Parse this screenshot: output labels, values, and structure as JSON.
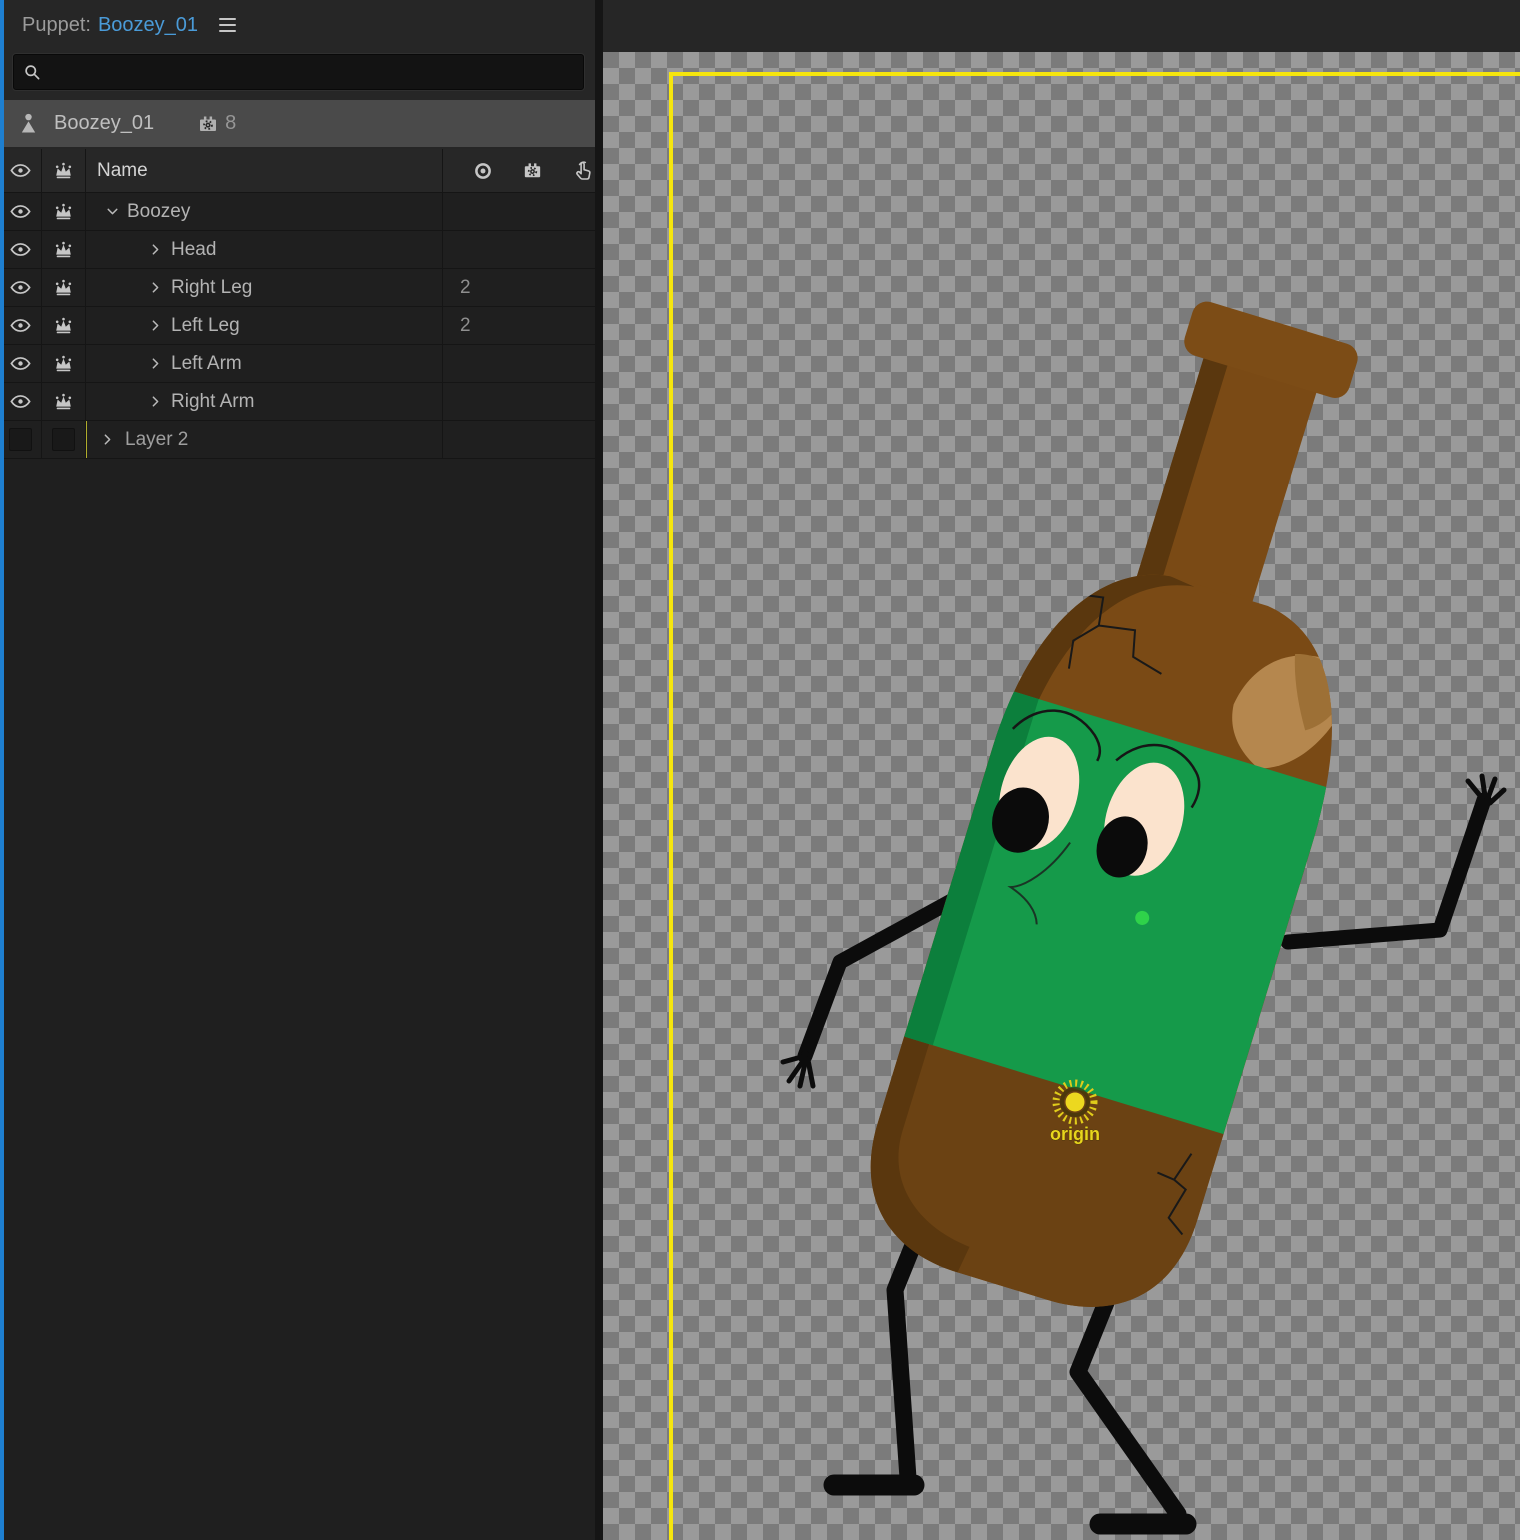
{
  "panel": {
    "accent_color": "#1e7fd0",
    "header": {
      "label": "Puppet:",
      "puppet_name": "Boozey_01"
    },
    "search": {
      "placeholder": ""
    },
    "selected_puppet": {
      "name": "Boozey_01",
      "behavior_count": "8"
    },
    "tree": {
      "name_column_header": "Name",
      "rows": [
        {
          "label": "Boozey",
          "value": "",
          "level": 0,
          "expanded": true
        },
        {
          "label": "Head",
          "value": "",
          "level": 1
        },
        {
          "label": "Right Leg",
          "value": "2",
          "level": 1
        },
        {
          "label": "Left Leg",
          "value": "2",
          "level": 1
        },
        {
          "label": "Left Arm",
          "value": "",
          "level": 1
        },
        {
          "label": "Right Arm",
          "value": "",
          "level": 1
        },
        {
          "label": "Layer 2",
          "value": "",
          "level": 0
        }
      ]
    }
  },
  "canvas": {
    "origin_label": "origin",
    "frame_color": "#f6e60d",
    "checker_light": "#9a9a9a",
    "checker_dark": "#7b7b7b",
    "character": {
      "bottle_brown": "#7a4a15",
      "bottle_brown_dark": "#5a370e",
      "bottle_brown_lower": "#6b4213",
      "label_green": "#159a4a",
      "label_green_dark": "#0c7f3c",
      "highlight_tan": "#b5874e",
      "highlight_mid": "#9d7036",
      "eye_cream": "#fbe3cd",
      "pupil_black": "#0b0b0b",
      "limb_black": "#0c0c0c",
      "origin_yellow": "#e8d41d",
      "nose_dot_green": "#2fd24a"
    }
  }
}
